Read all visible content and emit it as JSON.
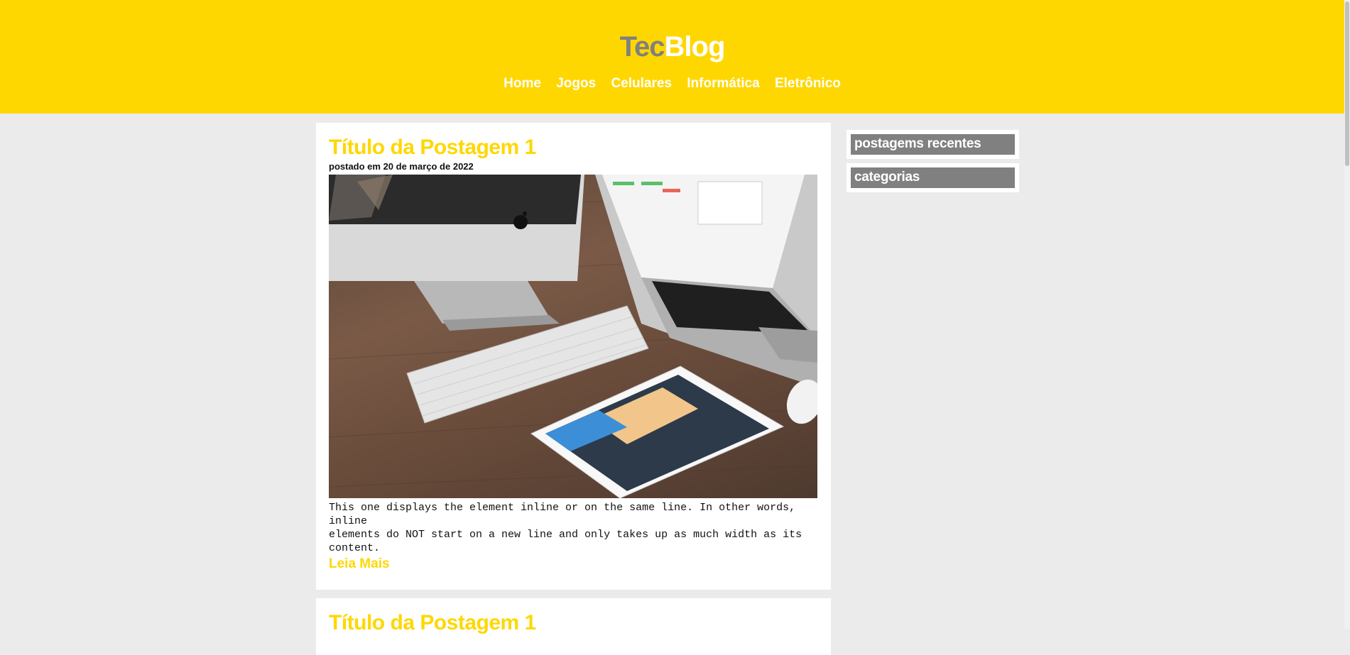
{
  "header": {
    "logo_part1": "Tec",
    "logo_part2": "Blog",
    "nav": [
      "Home",
      "Jogos",
      "Celulares",
      "Informática",
      "Eletrônico"
    ]
  },
  "posts": [
    {
      "title": "Título da Postagem 1",
      "date": "postado em 20 de março de 2022",
      "text": "This one displays the element inline or on the same line. In other words, inline\nelements do NOT start on a new line and only takes up as much width as its content.",
      "read_more": "Leia Mais",
      "image_icon": "laptop-desk-photo"
    },
    {
      "title": "Título da Postagem 1"
    }
  ],
  "sidebar": {
    "recent_title": "postagems recentes",
    "categories_title": "categorias"
  },
  "colors": {
    "accent": "#ffd700",
    "grey": "#808080",
    "background": "#ebebeb"
  }
}
